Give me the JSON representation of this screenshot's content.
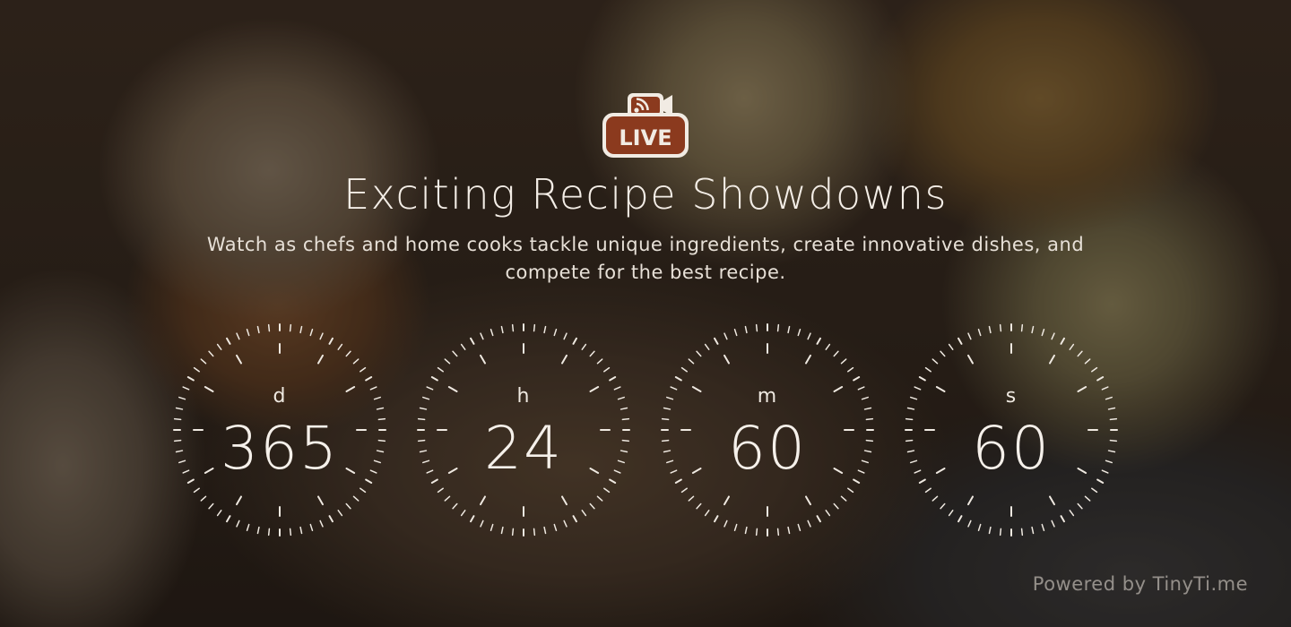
{
  "header": {
    "badge": {
      "icon": "live-camera-icon",
      "label": "LIVE",
      "color": "#8b3a1e"
    },
    "title": "Exciting Recipe Showdowns",
    "subtitle": "Watch as chefs and home cooks tackle unique ingredients, create innovative dishes, and compete for the best recipe."
  },
  "countdown": [
    {
      "unit": "d",
      "value": "365"
    },
    {
      "unit": "h",
      "value": "24"
    },
    {
      "unit": "m",
      "value": "60"
    },
    {
      "unit": "s",
      "value": "60"
    }
  ],
  "footer": {
    "powered_by": "Powered by TinyTi.me"
  },
  "colors": {
    "text": "#f3ede6",
    "badge": "#8b3a1e"
  }
}
